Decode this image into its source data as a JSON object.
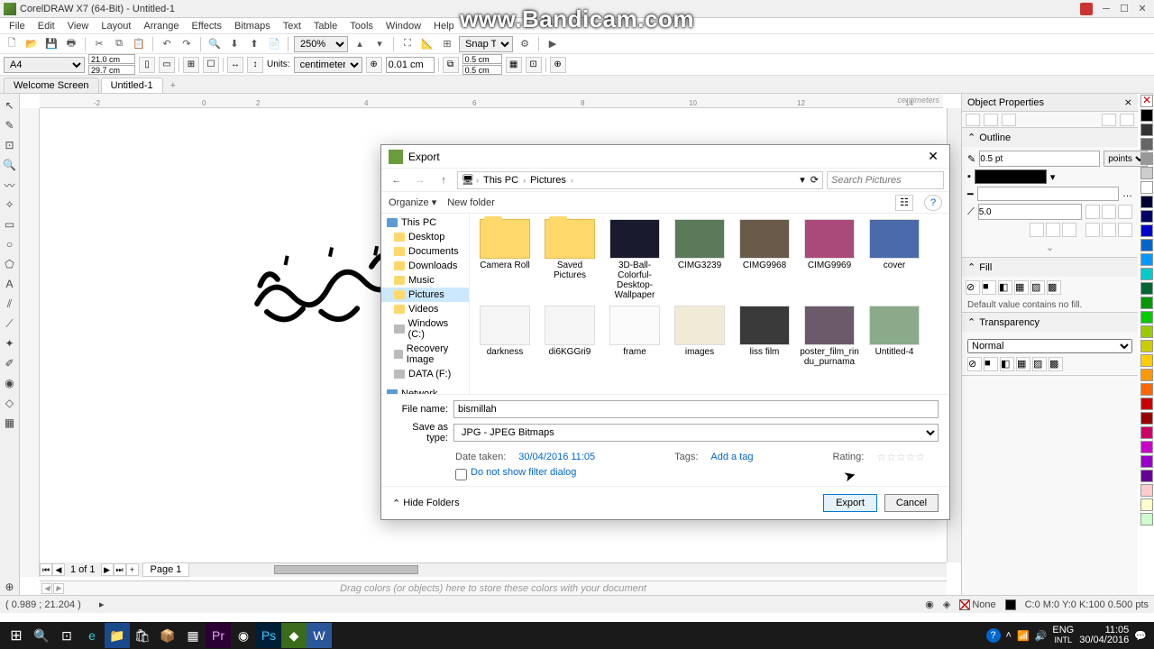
{
  "app": {
    "title": "CorelDRAW X7 (64-Bit) - Untitled-1",
    "watermark": "www.Bandicam.com"
  },
  "menu": [
    "File",
    "Edit",
    "View",
    "Layout",
    "Arrange",
    "Effects",
    "Bitmaps",
    "Text",
    "Table",
    "Tools",
    "Window",
    "Help"
  ],
  "toolbar": {
    "zoom": "250%",
    "snap": "Snap To"
  },
  "props": {
    "page_size": "A4",
    "width": "21.0 cm",
    "height": "29.7 cm",
    "units_label": "Units:",
    "units": "centimeters",
    "nudge": "0.01 cm",
    "dup_x": "0.5 cm",
    "dup_y": "0.5 cm"
  },
  "tabs": {
    "welcome": "Welcome Screen",
    "doc": "Untitled-1"
  },
  "ruler_unit": "centimeters",
  "pagetabs": {
    "info": "1 of 1",
    "page": "Page 1"
  },
  "color_strip_hint": "Drag colors (or objects) here to store these colors with your document",
  "docker": {
    "title": "Object Properties",
    "outline": {
      "label": "Outline",
      "width": "0.5 pt",
      "units": "points",
      "miter": "5.0"
    },
    "fill": {
      "label": "Fill",
      "info": "Default value contains no fill."
    },
    "transparency": {
      "label": "Transparency",
      "mode": "Normal"
    }
  },
  "status": {
    "coords": "( 0.989 ; 21.204 )",
    "fill_label": "None",
    "color_info": "C:0 M:0 Y:0 K:100  0.500 pts"
  },
  "taskbar": {
    "lang1": "ENG",
    "lang2": "INTL",
    "time": "11:05",
    "date": "30/04/2016"
  },
  "dialog": {
    "title": "Export",
    "path": {
      "pc": "This PC",
      "folder": "Pictures"
    },
    "search_placeholder": "Search Pictures",
    "organize": "Organize",
    "new_folder": "New folder",
    "tree": {
      "this_pc": "This PC",
      "desktop": "Desktop",
      "documents": "Documents",
      "downloads": "Downloads",
      "music": "Music",
      "pictures": "Pictures",
      "videos": "Videos",
      "windows_c": "Windows (C:)",
      "recovery": "Recovery Image",
      "data_f": "DATA (F:)",
      "network": "Network"
    },
    "files": [
      {
        "name": "Camera Roll",
        "type": "folder"
      },
      {
        "name": "Saved Pictures",
        "type": "folder"
      },
      {
        "name": "3D-Ball-Colorful-Desktop-Wallpaper",
        "type": "img",
        "bg": "#1a1a2e"
      },
      {
        "name": "CIMG3239",
        "type": "img",
        "bg": "#5a7a5a"
      },
      {
        "name": "CIMG9968",
        "type": "img",
        "bg": "#6a5a4a"
      },
      {
        "name": "CIMG9969",
        "type": "img",
        "bg": "#aa4a7a"
      },
      {
        "name": "cover",
        "type": "img",
        "bg": "#4a6aaa"
      },
      {
        "name": "darkness",
        "type": "img",
        "bg": "#f5f5f5"
      },
      {
        "name": "di6KGGri9",
        "type": "img",
        "bg": "#f5f5f5"
      },
      {
        "name": "frame",
        "type": "img",
        "bg": "#fafafa"
      },
      {
        "name": "images",
        "type": "img",
        "bg": "#f0ead6"
      },
      {
        "name": "liss film",
        "type": "img",
        "bg": "#3a3a3a"
      },
      {
        "name": "poster_film_rindu_purnama",
        "type": "img",
        "bg": "#6a5a6a"
      },
      {
        "name": "Untitled-4",
        "type": "img",
        "bg": "#8aaa8a"
      }
    ],
    "file_name_label": "File name:",
    "file_name": "bismillah",
    "save_type_label": "Save as type:",
    "save_type": "JPG - JPEG Bitmaps",
    "date_label": "Date taken:",
    "date_val": "30/04/2016 11:05",
    "tags_label": "Tags:",
    "tags_link": "Add a tag",
    "rating_label": "Rating:",
    "checkbox_label": "Do not show filter dialog",
    "hide_folders": "Hide Folders",
    "export_btn": "Export",
    "cancel_btn": "Cancel"
  }
}
